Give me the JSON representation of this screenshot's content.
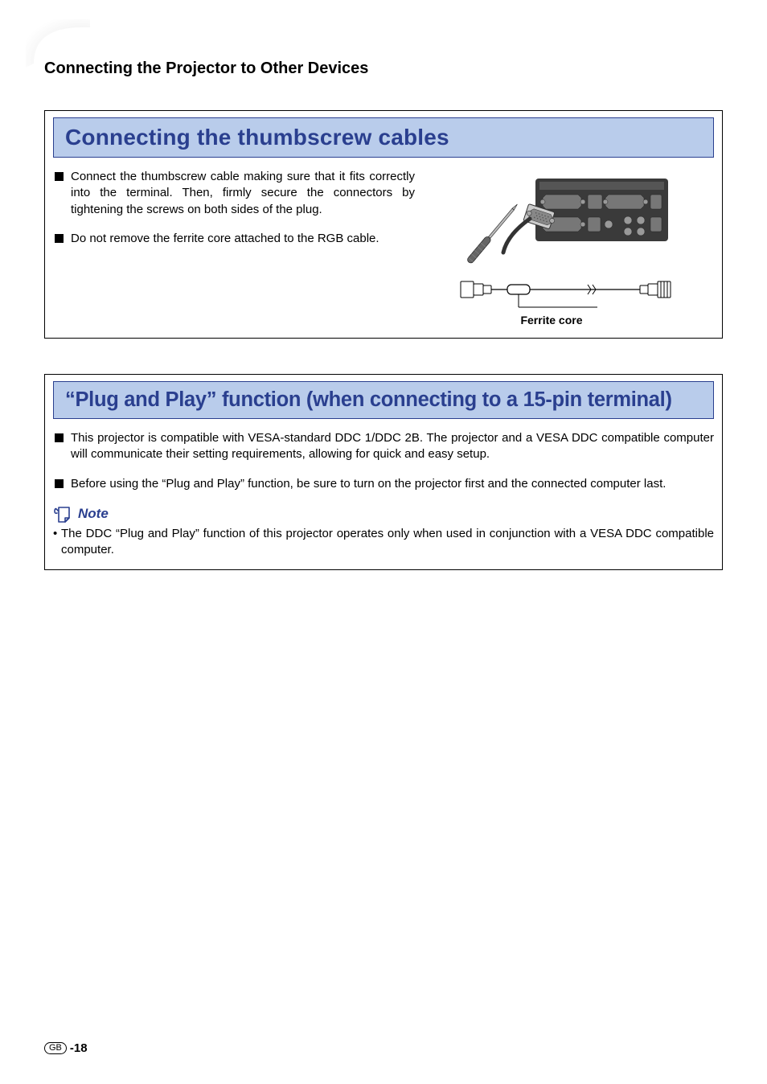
{
  "header": {
    "breadcrumb": "Connecting the Projector to Other Devices"
  },
  "section1": {
    "title": "Connecting the thumbscrew cables",
    "bullets": [
      "Connect the thumbscrew cable making sure that it fits correctly into the terminal. Then, firmly secure the connectors by tightening the screws on both sides of the plug.",
      "Do not remove the ferrite core attached to the RGB cable."
    ],
    "image_label": "Ferrite core"
  },
  "section2": {
    "title": "“Plug and Play” function (when connecting to a 15-pin terminal)",
    "bullets": [
      "This projector is compatible with VESA-standard DDC 1/DDC 2B. The projector and a VESA DDC compatible computer will communicate their setting requirements, allowing for quick and easy setup.",
      "Before using the “Plug and Play” function, be sure to turn on the projector first and the connected computer last."
    ],
    "note_label": "Note",
    "note_text": "The DDC “Plug and Play” function of this projector operates only when used in conjunction with a VESA DDC compatible computer."
  },
  "footer": {
    "region": "GB",
    "page": "-18"
  },
  "icons": {
    "note": "note-icon",
    "ferrite": "ferrite-core-icon",
    "connector_panel": "connector-panel-illustration",
    "cable": "rgb-cable-illustration"
  }
}
